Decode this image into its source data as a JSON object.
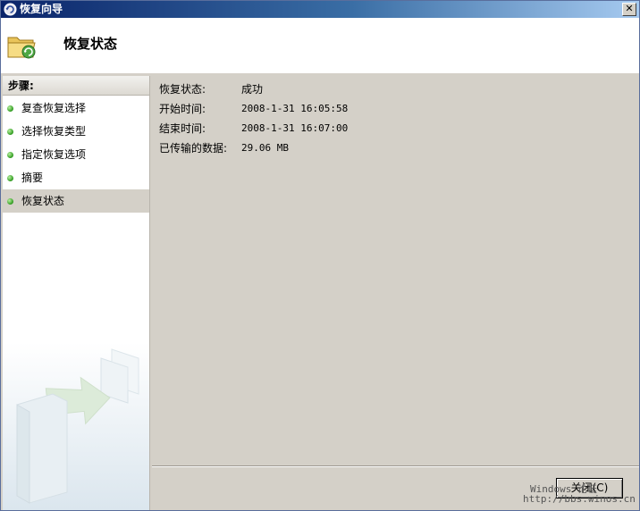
{
  "window": {
    "title": "恢复向导"
  },
  "header": {
    "title": "恢复状态"
  },
  "steps": {
    "heading": "步骤:",
    "items": [
      {
        "label": "复查恢复选择"
      },
      {
        "label": "选择恢复类型"
      },
      {
        "label": "指定恢复选项"
      },
      {
        "label": "摘要"
      },
      {
        "label": "恢复状态",
        "active": true
      }
    ]
  },
  "details": [
    {
      "label": "恢复状态:",
      "value": "成功"
    },
    {
      "label": "开始时间:",
      "value": "2008-1-31 16:05:58"
    },
    {
      "label": "结束时间:",
      "value": "2008-1-31 16:07:00"
    },
    {
      "label": "已传输的数据:",
      "value": "29.06 MB"
    }
  ],
  "footer": {
    "close_label": "关闭(C)",
    "watermark_text": "Windows 论坛",
    "watermark_url": "http://bbs.winos.cn"
  },
  "colors": {
    "step_dot": "#2e9a1e",
    "titlebar": "#0a246a",
    "active_step_bg": "#d4d0c8"
  }
}
